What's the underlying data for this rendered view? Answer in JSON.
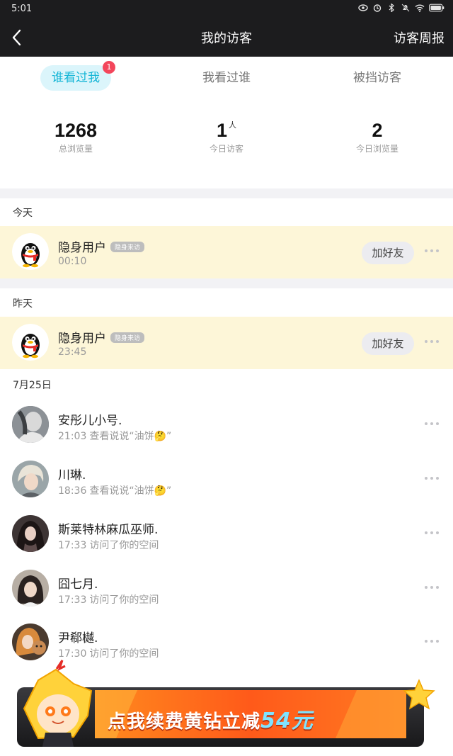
{
  "status_bar": {
    "time": "5:01"
  },
  "nav": {
    "title": "我的访客",
    "right_action": "访客周报"
  },
  "tabs": [
    {
      "label": "谁看过我",
      "active": true,
      "badge": "1"
    },
    {
      "label": "我看过谁",
      "active": false
    },
    {
      "label": "被挡访客",
      "active": false
    }
  ],
  "stats": [
    {
      "value": "1268",
      "unit": "",
      "label": "总浏览量"
    },
    {
      "value": "1",
      "unit": "人",
      "label": "今日访客"
    },
    {
      "value": "2",
      "unit": "",
      "label": "今日浏览量"
    }
  ],
  "sections": {
    "today": "今天",
    "yesterday": "昨天",
    "date": "7月25日"
  },
  "hidden_visitors": [
    {
      "name": "隐身用户",
      "tag": "隐身来访",
      "time": "00:10",
      "button": "加好友"
    },
    {
      "name": "隐身用户",
      "tag": "隐身来访",
      "time": "23:45",
      "button": "加好友"
    }
  ],
  "visitors": [
    {
      "name": "安彤儿小号.",
      "time": "21:03",
      "action": "查看说说“油饼🤔”"
    },
    {
      "name": "川琳.",
      "time": "18:36",
      "action": "查看说说“油饼🤔”"
    },
    {
      "name": "斯莱特林麻瓜巫师.",
      "time": "17:33",
      "action": "访问了你的空间"
    },
    {
      "name": "囧七月.",
      "time": "17:33",
      "action": "访问了你的空间"
    },
    {
      "name": "尹郗樾.",
      "time": "17:30",
      "action": "访问了你的空间"
    }
  ],
  "banner": {
    "text": "点我续费黄钻立减",
    "amount": "54元"
  },
  "colors": {
    "accent": "#13b5d6",
    "highlight_row": "#fdf6d8",
    "badge": "#f3465b",
    "dark_bar": "#1c1c1e"
  }
}
